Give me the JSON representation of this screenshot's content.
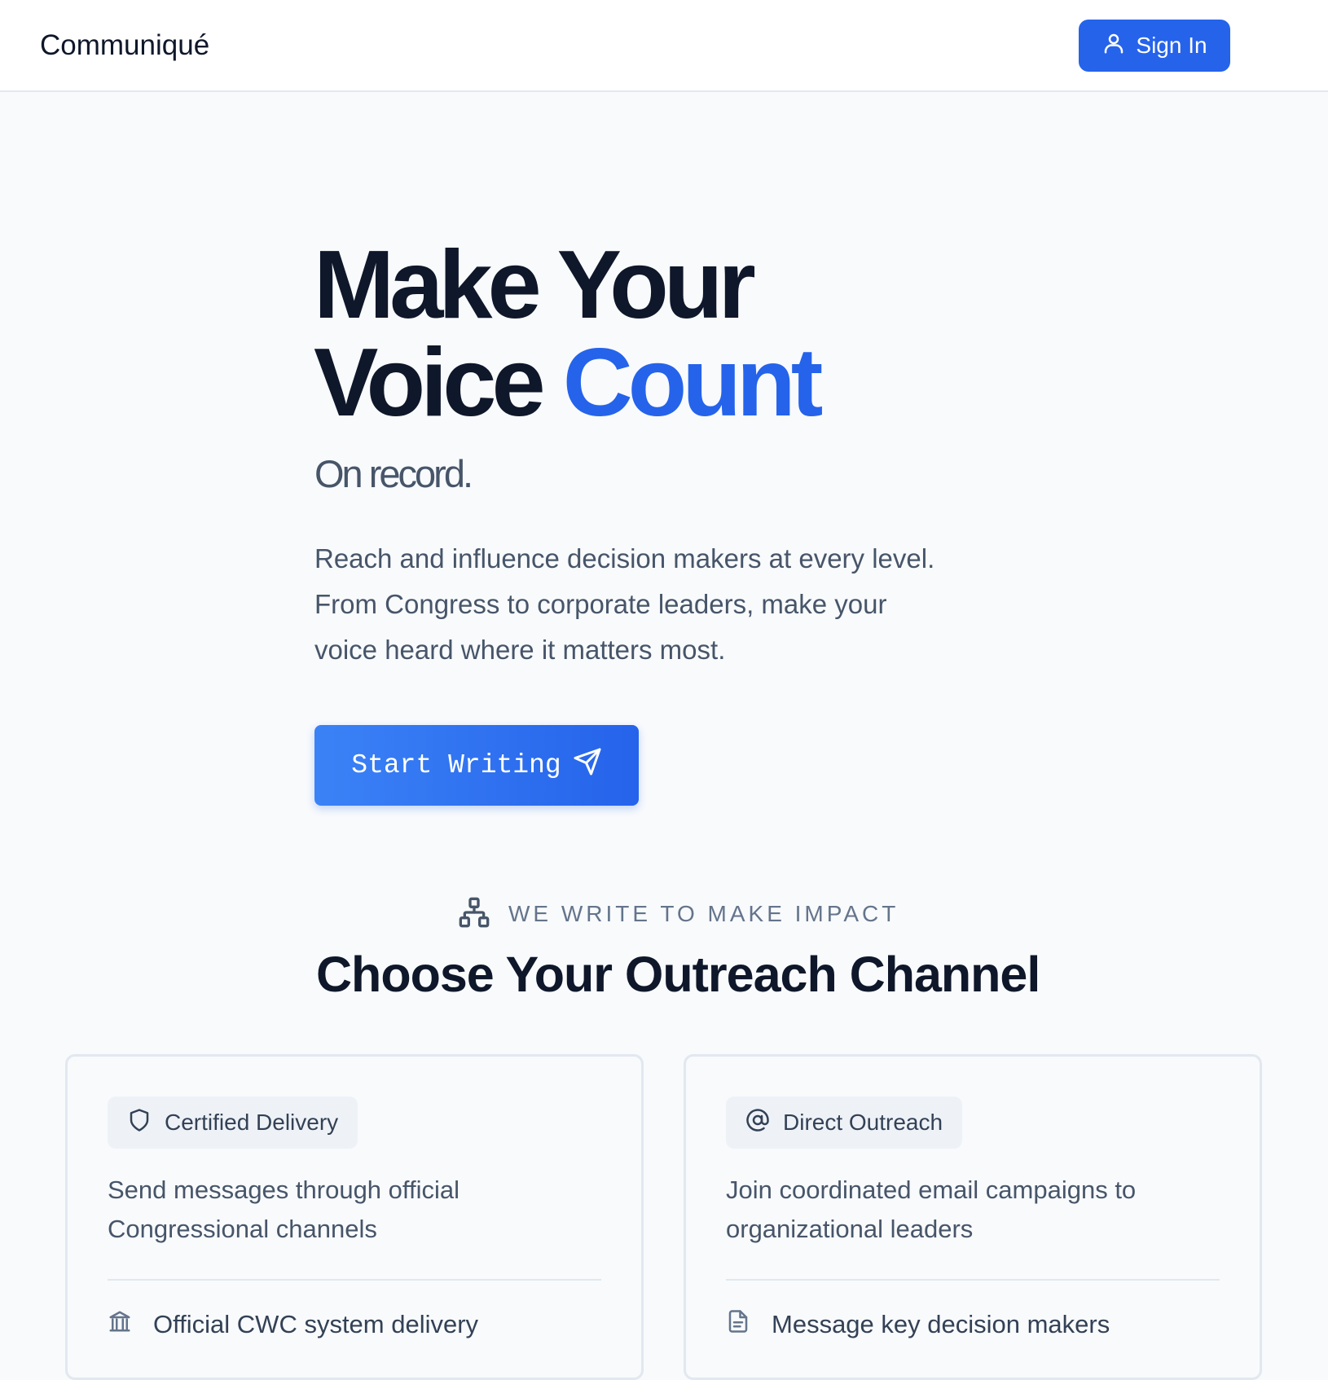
{
  "header": {
    "brand": "Communiqué",
    "signin_label": "Sign In",
    "signin_icon": "user-icon"
  },
  "hero": {
    "title_line1": "Make Your",
    "title_line2_plain": "Voice ",
    "title_line2_accent": "Count",
    "subtitle": "On record.",
    "description_line1": "Reach and influence decision makers at every level.",
    "description_line2": "From Congress to corporate leaders, make your",
    "description_line3": "voice heard where it matters most.",
    "cta_label": "Start Writing",
    "cta_icon": "send-icon"
  },
  "section": {
    "eyebrow": "WE WRITE TO MAKE IMPACT",
    "eyebrow_icon": "network-icon",
    "title": "Choose Your Outreach Channel"
  },
  "cards": [
    {
      "badge": "Certified Delivery",
      "badge_icon": "shield-icon",
      "desc_line1": "Send messages through official",
      "desc_line2": "Congressional channels",
      "feature": "Official CWC system delivery",
      "feature_icon": "landmark-icon"
    },
    {
      "badge": "Direct Outreach",
      "badge_icon": "at-sign-icon",
      "desc_line1": "Join coordinated email campaigns to",
      "desc_line2": "organizational leaders",
      "feature": "Message key decision makers",
      "feature_icon": "document-icon"
    }
  ],
  "colors": {
    "accent": "#2563eb",
    "background": "#f8fafc",
    "text_primary": "#0f172a",
    "text_secondary": "#475569"
  }
}
